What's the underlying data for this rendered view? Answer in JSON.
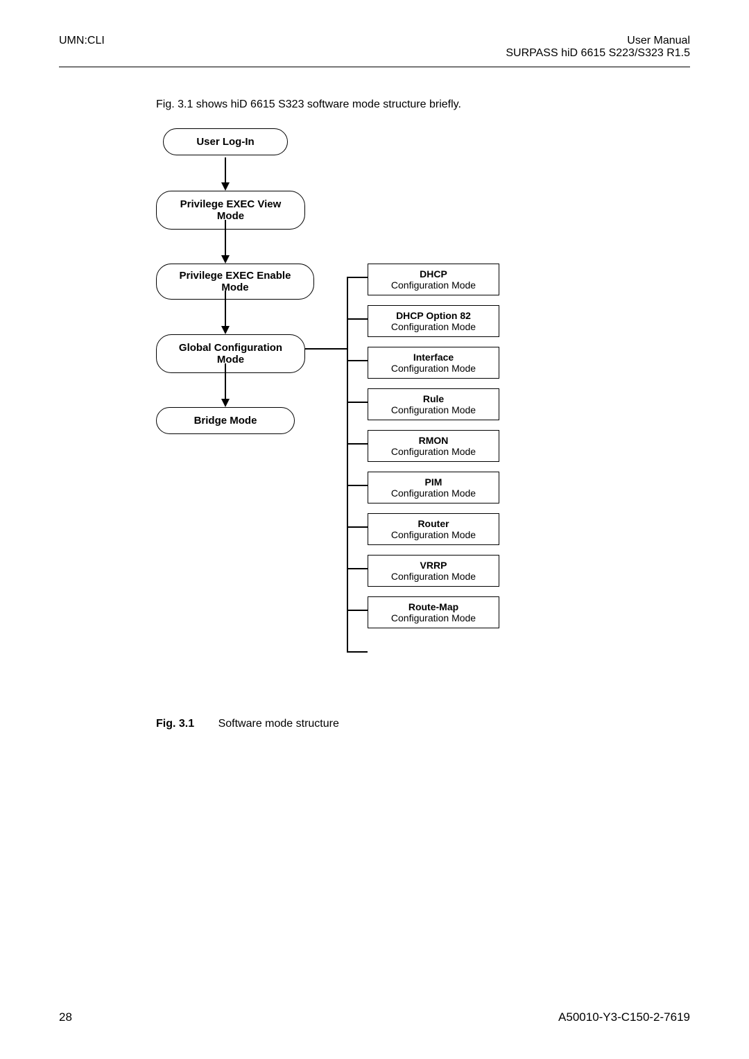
{
  "header": {
    "left": "UMN:CLI",
    "right_line1": "User  Manual",
    "right_line2": "SURPASS hiD 6615 S223/S323 R1.5"
  },
  "intro_text": "Fig. 3.1 shows hiD 6615 S323 software mode structure briefly.",
  "diagram": {
    "user_login": "User Log-In",
    "priv_view": "Privilege EXEC View Mode",
    "priv_enable": "Privilege EXEC Enable Mode",
    "global_config": "Global Configuration Mode",
    "bridge_mode": "Bridge Mode",
    "dhcp_title": "DHCP",
    "dhcp_sub": "Configuration Mode",
    "dhcp82_title": "DHCP Option 82",
    "dhcp82_sub": "Configuration Mode",
    "interface_title": "Interface",
    "interface_sub": "Configuration Mode",
    "rule_title": "Rule",
    "rule_sub": "Configuration Mode",
    "rmon_title": "RMON",
    "rmon_sub": "Configuration Mode",
    "pim_title": "PIM",
    "pim_sub": "Configuration Mode",
    "router_title": "Router",
    "router_sub": "Configuration Mode",
    "vrrp_title": "VRRP",
    "vrrp_sub": "Configuration Mode",
    "routemap_title": "Route-Map",
    "routemap_sub": "Configuration Mode"
  },
  "caption": {
    "fig_num": "Fig. 3.1",
    "text": "Software mode structure"
  },
  "footer": {
    "page": "28",
    "code": "A50010-Y3-C150-2-7619"
  }
}
